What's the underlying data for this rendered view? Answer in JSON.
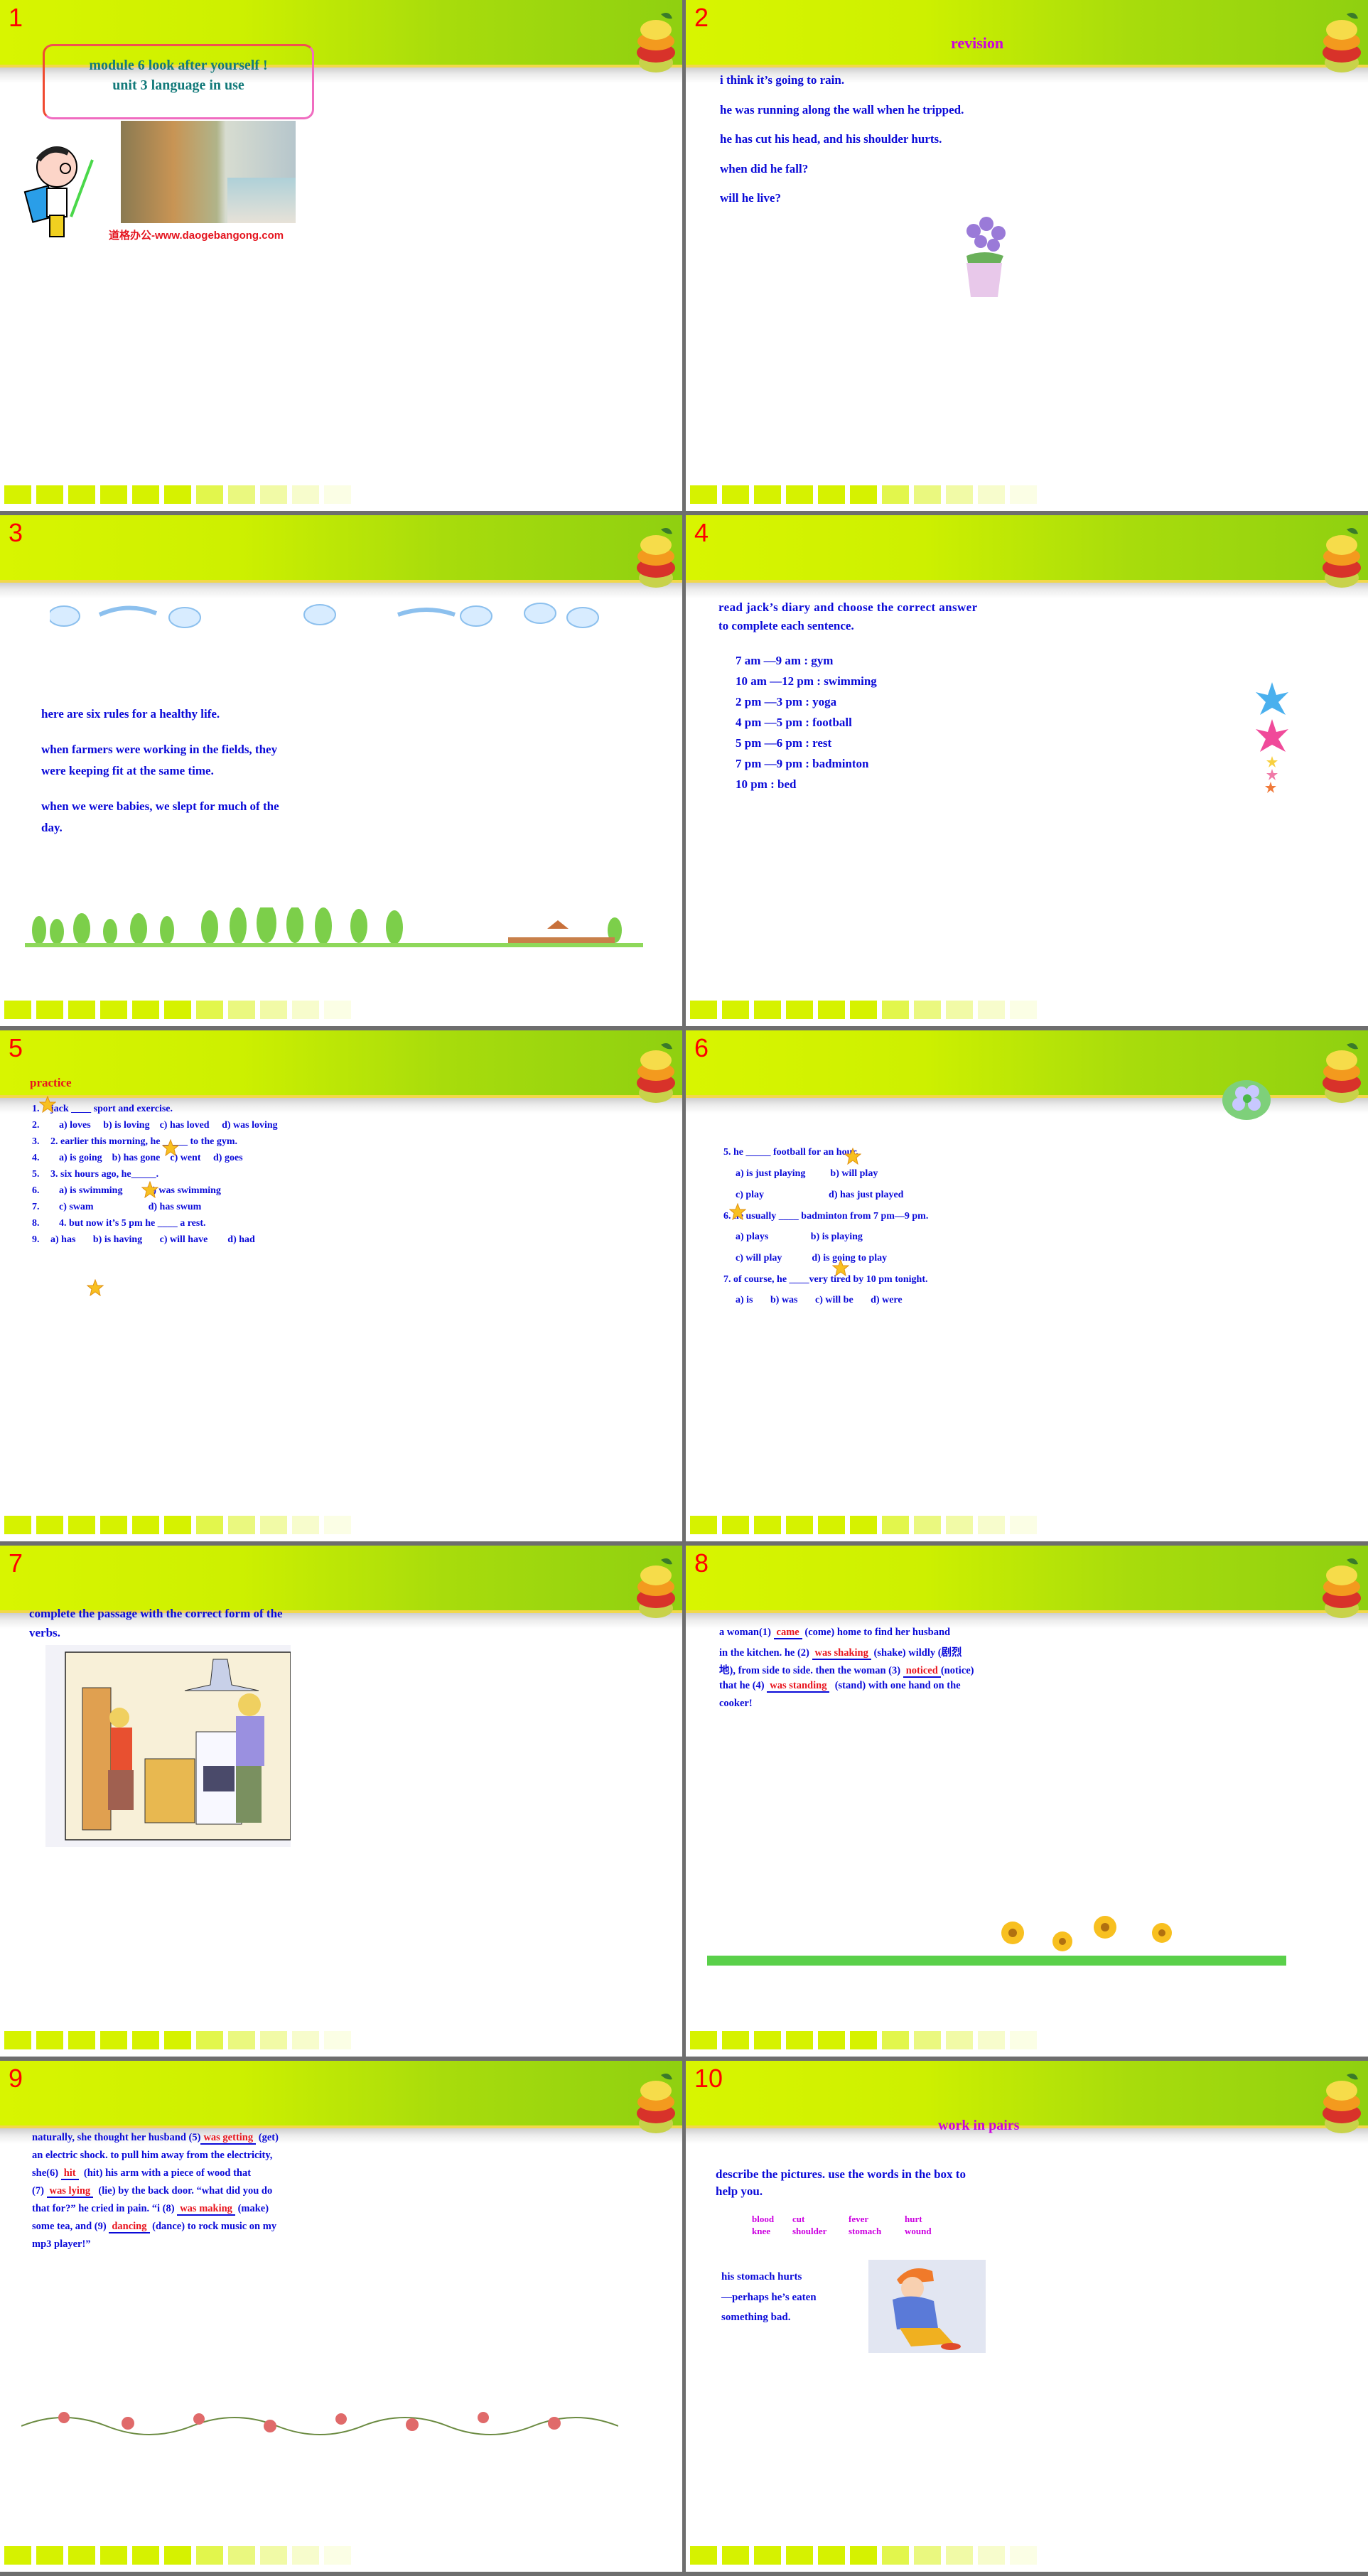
{
  "watermark": "道格办公",
  "slides": [
    {
      "number": "1",
      "title_line1": "module  6   look after yourself !",
      "title_line2": "unit 3  language in use",
      "url": "道格办公-www.daogebangong.com"
    },
    {
      "number": "2",
      "heading": "revision",
      "lines": [
        "i think it’s going to rain.",
        "he was running along the wall when he tripped.",
        "he has cut his head, and his shoulder hurts.",
        "when did he fall?",
        "will he live?"
      ]
    },
    {
      "number": "3",
      "lines": [
        "here are six rules for a healthy life.",
        "when farmers were working in the fields, they",
        "were keeping fit at the same time.",
        "when we were babies, we slept for much of the",
        "day."
      ]
    },
    {
      "number": "4",
      "intro_line1": "read jack’s diary and choose the correct answer",
      "intro_line2": "to complete each sentence.",
      "diary": [
        "7 am —9 am : gym",
        "10 am —12 pm : swimming",
        "2 pm —3 pm : yoga",
        "4 pm —5 pm : football",
        "5 pm —6 pm : rest",
        "7 pm —9 pm : badminton",
        "10 pm : bed"
      ]
    },
    {
      "number": "5",
      "heading": "practice",
      "items": [
        {
          "num": "1.",
          "text": "jack ____ sport and exercise."
        },
        {
          "num": "2.",
          "text": "a) loves     b) is loving    c) has loved     d) was loving"
        },
        {
          "num": "3.",
          "text": "2. earlier this morning, he _____ to the gym."
        },
        {
          "num": "4.",
          "text": "a) is going    b) has gone    c) went     d) goes"
        },
        {
          "num": "5.",
          "text": "3. six hours ago, he_____."
        },
        {
          "num": "6.",
          "text": "a) is swimming          b) was swimming"
        },
        {
          "num": "7.",
          "text": "c) swam                      d) has swum"
        },
        {
          "num": "8.",
          "text": "4. but now it’s 5 pm he ____ a rest."
        },
        {
          "num": "9.",
          "text": "a) has       b) is having       c) will have        d) had"
        }
      ]
    },
    {
      "number": "6",
      "items": [
        "5. he _____ football for an hour.",
        "a) is just playing          b) will play",
        "c) play                          d) has just played",
        "6. he usually ____ badminton from 7 pm—9 pm.",
        "a) plays                 b) is playing",
        "c) will play            d) is going to play",
        "7. of course, he ____very tired by 10 pm tonight.",
        "a) is       b) was       c) will be       d) were"
      ]
    },
    {
      "number": "7",
      "instruction_line1": "complete the passage with the correct form of the",
      "instruction_line2": "verbs."
    },
    {
      "number": "8",
      "passage": [
        {
          "pre": "a woman(1) ",
          "answer": "came",
          "post": " (come) home to find her husband"
        },
        {
          "pre": "in the kitchen. he (2) ",
          "answer": "was shaking",
          "post": " (shake) wildly (剧烈"
        },
        {
          "pre": "地), from side to side. then the woman (3) ",
          "answer": "noticed",
          "post": "(notice)"
        },
        {
          "pre": "that he (4) ",
          "answer": "was standing",
          "post": "  (stand) with one hand on the"
        },
        {
          "pre": "cooker!",
          "answer": "",
          "post": ""
        }
      ]
    },
    {
      "number": "9",
      "passage": [
        {
          "pre": "naturally, she thought her husband (5)",
          "answer": "was getting",
          "post": " (get)"
        },
        {
          "pre": "an electric shock. to pull him away from the electricity,",
          "answer": "",
          "post": ""
        },
        {
          "pre": "she(6) ",
          "answer": "hit",
          "post": "  (hit) his arm with a piece of wood that"
        },
        {
          "pre": "(7) ",
          "answer": "was lying",
          "post": "  (lie) by the back door. “what did you do"
        },
        {
          "pre": "that for?” he cried in pain. “i (8) ",
          "answer": "was making",
          "post": " (make)"
        },
        {
          "pre": "some tea, and (9) ",
          "answer": "dancing",
          "post": " (dance) to rock music on my"
        },
        {
          "pre": "mp3 player!”",
          "answer": "",
          "post": ""
        }
      ]
    },
    {
      "number": "10",
      "heading": "work in pairs",
      "instruction_line1": "describe the pictures. use the words in the box to",
      "instruction_line2": "help you.",
      "word_box": [
        [
          "blood",
          "cut",
          "fever",
          "hurt"
        ],
        [
          "knee",
          "shoulder",
          "stomach",
          "wound"
        ]
      ],
      "example": [
        "his stomach hurts",
        "—perhaps he’s eaten",
        "something bad."
      ]
    }
  ],
  "colors": {
    "header_green": "#cdf000",
    "text_blue": "#0a0ad8",
    "heading_magenta": "#cc00e0",
    "answer_red": "#e8141e",
    "title_teal": "#137a7a",
    "slide_number_red": "#ff0000"
  }
}
